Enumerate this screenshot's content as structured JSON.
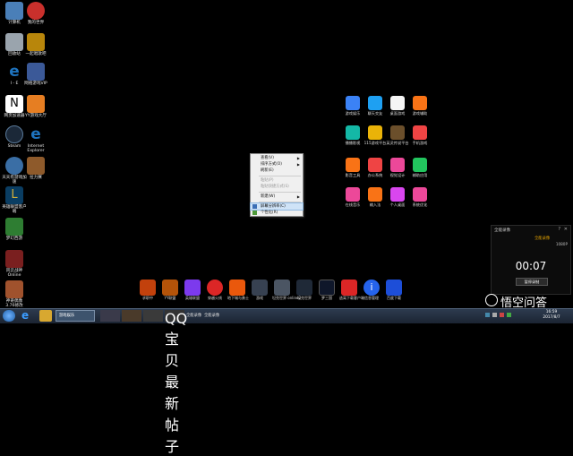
{
  "desktop_icons": [
    {
      "label": "计算机",
      "color": "#4a7fb8"
    },
    {
      "label": "我的世界",
      "color": "#c9302c"
    },
    {
      "label": "回收站",
      "color": "#9aa4ad"
    },
    {
      "label": "一起唱歌吧",
      "color": "#b8860b"
    },
    {
      "label": "I - E",
      "color": "#1e73be"
    },
    {
      "label": "网络游戏VIP",
      "color": "#3b5998"
    },
    {
      "label": "网页加速器",
      "color": "#ffffff"
    },
    {
      "label": "YY游戏大厅",
      "color": "#e67e22"
    },
    {
      "label": "Steam",
      "color": "#1b2838"
    },
    {
      "label": "Internet Explorer",
      "color": "#1e73be"
    },
    {
      "label": "天天有游戏加速",
      "color": "#3a6ea5"
    },
    {
      "label": "拉力赛",
      "color": "#8e5a2b"
    },
    {
      "label": "英雄联盟客户端",
      "color": "#0a3d62"
    },
    {
      "label": "梦幻西游",
      "color": "#2e7d32"
    },
    {
      "label": "风云战神 Online",
      "color": "#7a1f1f"
    },
    {
      "label": "神奇偶像 3.76修改",
      "color": "#a0522d"
    }
  ],
  "app_grid": [
    {
      "label": "游戏娱乐",
      "color": "#3b82f6"
    },
    {
      "label": "聊天交友",
      "color": "#1ea0f2"
    },
    {
      "label": "桌面游戏",
      "color": "#f5f5f5"
    },
    {
      "label": "游戏辅助",
      "color": "#f97316"
    },
    {
      "label": "播播影视",
      "color": "#14b8a6"
    },
    {
      "label": "115游戏平台",
      "color": "#eab308"
    },
    {
      "label": "英灵传说平台",
      "color": "#6b4f2b"
    },
    {
      "label": "手机游戏",
      "color": "#ef4444"
    },
    {
      "label": "影音工具",
      "color": "#f97316"
    },
    {
      "label": "办公系统",
      "color": "#ef4444"
    },
    {
      "label": "视觉设计",
      "color": "#ec4899"
    },
    {
      "label": "辅助应用",
      "color": "#22c55e"
    },
    {
      "label": "在线音乐",
      "color": "#ec4899"
    },
    {
      "label": "输入法",
      "color": "#f97316"
    },
    {
      "label": "个人桌面",
      "color": "#d946ef"
    },
    {
      "label": "系统优化",
      "color": "#ec4899"
    }
  ],
  "dock_items": [
    {
      "label": "求职中",
      "color": "#c2410c"
    },
    {
      "label": "YY联盟",
      "color": "#b45309"
    },
    {
      "label": "英雄联盟",
      "color": "#7c3aed"
    },
    {
      "label": "穿越火线",
      "color": "#dc2626"
    },
    {
      "label": "地下城与勇士",
      "color": "#ea580c"
    },
    {
      "label": "游戏",
      "color": "#374151"
    },
    {
      "label": "坦克世界 online2",
      "color": "#4b5563"
    },
    {
      "label": "坦克世界",
      "color": "#1f2937"
    },
    {
      "label": "梦三国",
      "color": "#0f172a"
    },
    {
      "label": "逃离下载客户端",
      "color": "#dc2626"
    },
    {
      "label": "信息管理",
      "color": "#2563eb"
    },
    {
      "label": "百度下载",
      "color": "#1d4ed8"
    }
  ],
  "context_menu": {
    "items": [
      {
        "label": "查看(V)",
        "disabled": false,
        "submenu": true
      },
      {
        "label": "排序方式(O)",
        "disabled": false,
        "submenu": true
      },
      {
        "label": "刷新(E)",
        "disabled": false,
        "submenu": false
      },
      {
        "label": "粘贴(P)",
        "disabled": true,
        "submenu": false
      },
      {
        "label": "粘贴快捷方式(S)",
        "disabled": true,
        "submenu": false
      },
      {
        "label": "新建(W)",
        "disabled": false,
        "submenu": true
      },
      {
        "label": "屏幕分辨率(C)",
        "disabled": false,
        "submenu": false,
        "highlighted": true
      },
      {
        "label": "个性化(R)",
        "disabled": false,
        "submenu": false
      }
    ]
  },
  "stopwatch": {
    "title": "全能录像",
    "tab": "全能录像",
    "resolution": "1080P",
    "time": "00:07",
    "stop_label": "暂停录制"
  },
  "taskbar": {
    "tasks": [
      "游戏娱乐",
      "",
      "",
      "",
      "QQ宝贝 最新帖子",
      "全能录像"
    ],
    "tray_time": "16:59",
    "tray_date": "2017/8/7"
  },
  "watermark": "悟空问答"
}
